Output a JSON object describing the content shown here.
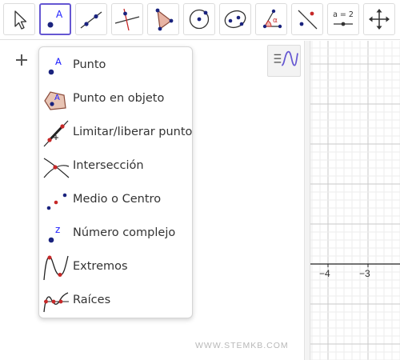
{
  "toolbar": {
    "tools": [
      {
        "name": "Mover",
        "icon": "move-arrow-icon"
      },
      {
        "name": "Punto",
        "icon": "point-icon",
        "glyph": "A",
        "selected": true
      },
      {
        "name": "Recta",
        "icon": "line-icon"
      },
      {
        "name": "Perpendicular",
        "icon": "perpendicular-line-icon"
      },
      {
        "name": "Polígono",
        "icon": "polygon-icon"
      },
      {
        "name": "Circunferencia",
        "icon": "circle-icon"
      },
      {
        "name": "Elipse",
        "icon": "ellipse-icon"
      },
      {
        "name": "Ángulo",
        "icon": "angle-icon",
        "glyph": "α"
      },
      {
        "name": "Simetría axial",
        "icon": "reflect-icon"
      },
      {
        "name": "Deslizador",
        "icon": "slider-icon",
        "glyph": "a = 2"
      },
      {
        "name": "Desplazar vista",
        "icon": "move-view-icon"
      }
    ]
  },
  "menu": {
    "items": [
      {
        "label": "Punto",
        "icon": "point-icon",
        "glyph": "A"
      },
      {
        "label": "Punto en objeto",
        "icon": "point-on-object-icon",
        "glyph": "A"
      },
      {
        "label": "Limitar/liberar punto",
        "icon": "attach-detach-point-icon"
      },
      {
        "label": "Intersección",
        "icon": "intersect-icon"
      },
      {
        "label": "Medio o Centro",
        "icon": "midpoint-icon"
      },
      {
        "label": "Número complejo",
        "icon": "complex-number-icon",
        "glyph": "z"
      },
      {
        "label": "Extremos",
        "icon": "extremum-icon"
      },
      {
        "label": "Raíces",
        "icon": "roots-icon"
      }
    ]
  },
  "graphics": {
    "x_ticks": [
      "−4",
      "−3"
    ]
  },
  "watermark": "WWW.STEMKB.COM",
  "colors": {
    "accent": "#6557d2",
    "point_blue": "#1a237e",
    "label_blue": "#2020ff",
    "point_red": "#c62828",
    "grid_major": "#c8c8c8",
    "grid_minor": "#ececec"
  }
}
